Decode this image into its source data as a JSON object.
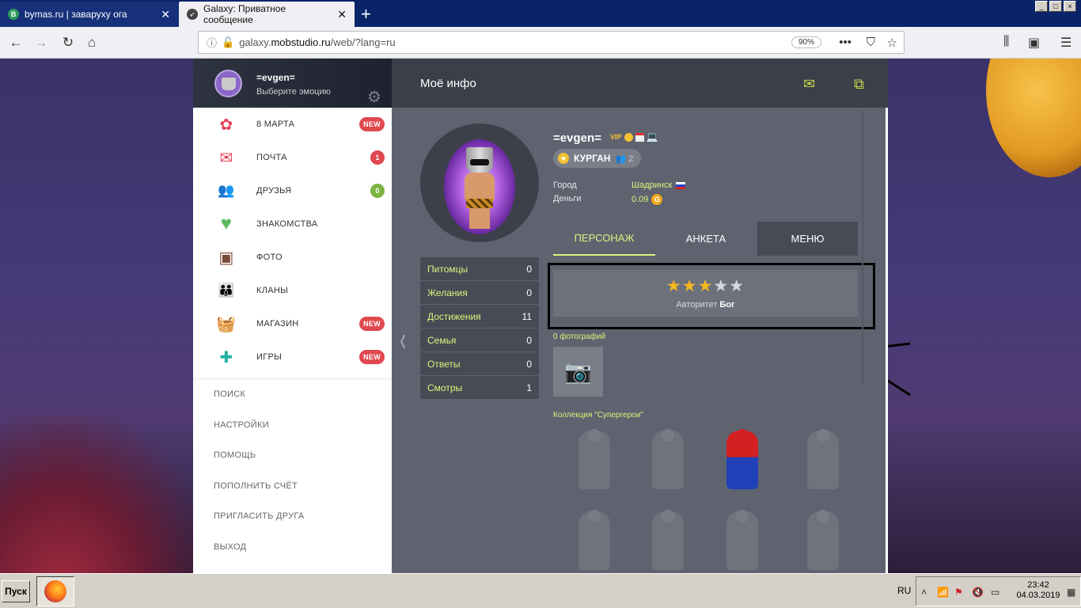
{
  "browser": {
    "tabs": [
      {
        "label": "bymas.ru | заваруху ога",
        "favicon": "B"
      },
      {
        "label": "Galaxy: Приватное сообщение"
      }
    ],
    "url_prefix": "galaxy.",
    "url_host": "mobstudio.ru",
    "url_path": "/web/?lang=ru",
    "zoom": "90%"
  },
  "sidebar": {
    "username": "=evgen=",
    "emotion_prompt": "Выберите эмоцию",
    "items": [
      {
        "label": "8 МАРТА",
        "badge": "NEW",
        "icon": "flower-icon",
        "color": "#e8425a"
      },
      {
        "label": "ПОЧТА",
        "badge": "1",
        "icon": "mail-icon",
        "color": "#e8425a"
      },
      {
        "label": "ДРУЗЬЯ",
        "badge": "0",
        "icon": "friends-icon",
        "color": "#3aa0dc"
      },
      {
        "label": "ЗНАКОМСТВА",
        "badge": "",
        "icon": "heart-icon",
        "color": "#5fb85f"
      },
      {
        "label": "ФОТО",
        "badge": "",
        "icon": "photo-icon",
        "color": "#7a4a3a"
      },
      {
        "label": "КЛАНЫ",
        "badge": "",
        "icon": "clans-icon",
        "color": "#4050c8"
      },
      {
        "label": "МАГАЗИН",
        "badge": "NEW",
        "icon": "basket-icon",
        "color": "#e8425a"
      },
      {
        "label": "ИГРЫ",
        "badge": "NEW",
        "icon": "puzzle-icon",
        "color": "#20b0a0"
      }
    ],
    "secondary": [
      "ПОИСК",
      "НАСТРОЙКИ",
      "ПОМОЩЬ",
      "ПОПОЛНИТЬ СЧЁТ",
      "ПРИГЛАСИТЬ ДРУГА",
      "ВЫХОД"
    ]
  },
  "header": {
    "title": "Моё инфо"
  },
  "profile": {
    "name": "=evgen=",
    "vip": "VIP",
    "clan": "КУРГАН",
    "clan_members": "2",
    "city_label": "Город",
    "city": "Шадринск",
    "money_label": "Деньги",
    "money": "0.09",
    "coin_symbol": "G"
  },
  "tabs": [
    "ПЕРСОНАЖ",
    "АНКЕТА",
    "МЕНЮ"
  ],
  "stats": [
    {
      "label": "Питомцы",
      "value": "0"
    },
    {
      "label": "Желания",
      "value": "0"
    },
    {
      "label": "Достижения",
      "value": "11"
    },
    {
      "label": "Семья",
      "value": "0"
    },
    {
      "label": "Ответы",
      "value": "0"
    },
    {
      "label": "Смотры",
      "value": "1"
    }
  ],
  "authority": {
    "label": "Авторитет",
    "rank": "Бог",
    "stars_filled": 3,
    "stars_total": 5
  },
  "photos_label": "0 фотографий",
  "collection_label": "Коллекция \"Супергерои\"",
  "taskbar": {
    "start": "Пуск",
    "lang": "RU",
    "time": "23:42",
    "date": "04.03.2019"
  }
}
